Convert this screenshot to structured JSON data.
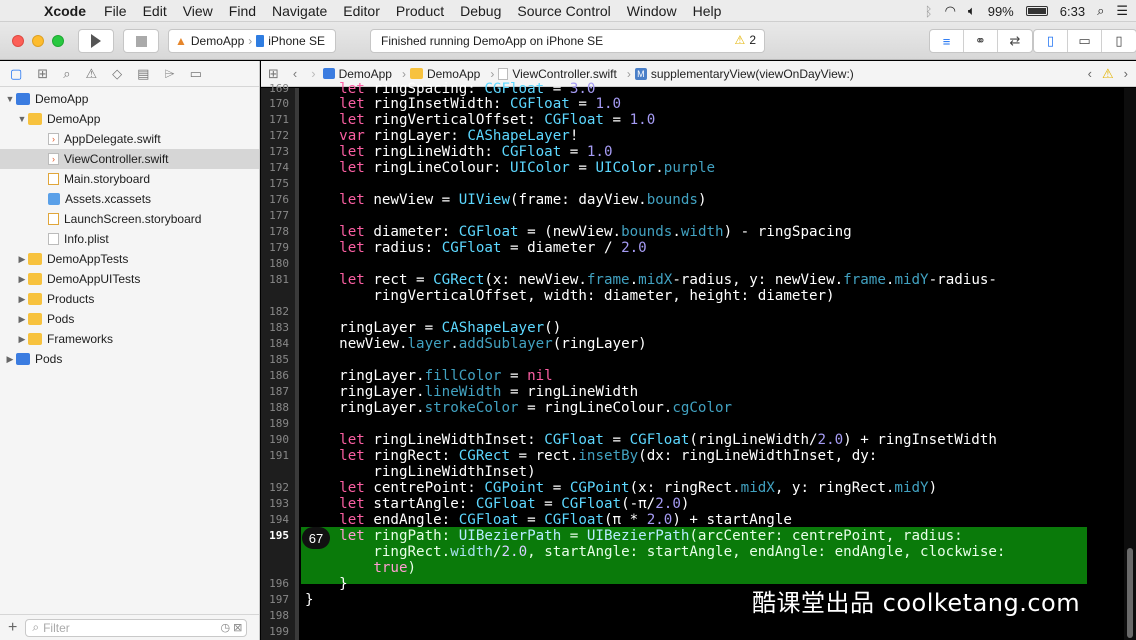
{
  "menubar": {
    "apple": "",
    "app": "Xcode",
    "items": [
      "File",
      "Edit",
      "View",
      "Find",
      "Navigate",
      "Editor",
      "Product",
      "Debug",
      "Source Control",
      "Window",
      "Help"
    ],
    "battery": "99%",
    "time": "6:33"
  },
  "toolbar": {
    "scheme_app": "DemoApp",
    "scheme_device": "iPhone SE",
    "status": "Finished running DemoApp on iPhone SE",
    "warning_count": "2"
  },
  "navigator": {
    "items": [
      {
        "label": "DemoApp",
        "icon": "project-icon",
        "tri": "▼"
      },
      {
        "label": "DemoApp",
        "icon": "folder-icon",
        "tri": "▼"
      },
      {
        "label": "AppDelegate.swift",
        "icon": "swift-file-icon",
        "tri": ""
      },
      {
        "label": "ViewController.swift",
        "icon": "swift-file-icon",
        "tri": "",
        "selected": true
      },
      {
        "label": "Main.storyboard",
        "icon": "storyboard-icon",
        "tri": ""
      },
      {
        "label": "Assets.xcassets",
        "icon": "assets-icon",
        "tri": ""
      },
      {
        "label": "LaunchScreen.storyboard",
        "icon": "storyboard-icon",
        "tri": ""
      },
      {
        "label": "Info.plist",
        "icon": "plist-icon",
        "tri": ""
      },
      {
        "label": "DemoAppTests",
        "icon": "folder-icon",
        "tri": "▶"
      },
      {
        "label": "DemoAppUITests",
        "icon": "folder-icon",
        "tri": "▶"
      },
      {
        "label": "Products",
        "icon": "folder-icon",
        "tri": "▶"
      },
      {
        "label": "Pods",
        "icon": "folder-icon",
        "tri": "▶"
      },
      {
        "label": "Frameworks",
        "icon": "folder-icon",
        "tri": "▶"
      },
      {
        "label": "Pods",
        "icon": "project-icon",
        "tri": "▶"
      }
    ],
    "filter_placeholder": "Filter"
  },
  "jumpbar": {
    "crumbs": [
      "DemoApp",
      "DemoApp",
      "ViewController.swift",
      "supplementaryView(viewOnDayView:)"
    ]
  },
  "editor": {
    "line_numbers": [
      "169",
      "170",
      "171",
      "172",
      "173",
      "174",
      "175",
      "176",
      "177",
      "178",
      "179",
      "180",
      "181",
      "182",
      "183",
      "184",
      "185",
      "186",
      "187",
      "188",
      "189",
      "190",
      "191",
      "192",
      "193",
      "194",
      "195",
      "196",
      "197",
      "198",
      "199"
    ],
    "breakpoint_hits": "67"
  },
  "watermark": "酷课堂出品 coolketang.com"
}
